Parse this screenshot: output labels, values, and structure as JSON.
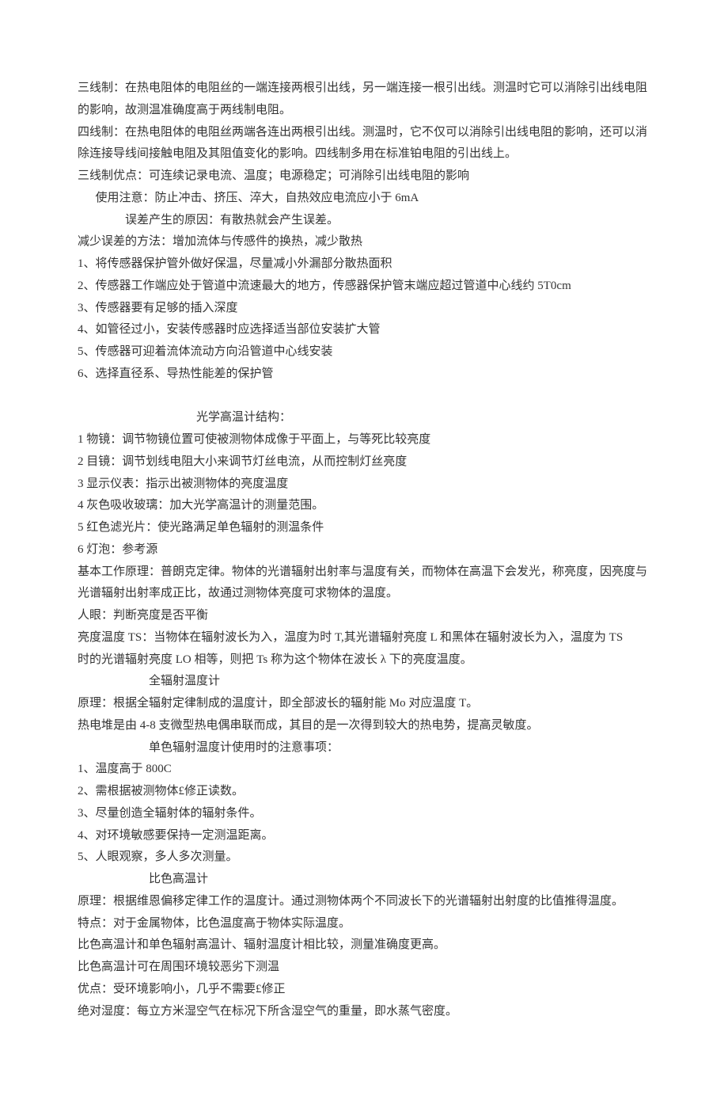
{
  "lines": {
    "l1": "三线制：在热电阻体的电阻丝的一端连接两根引出线，另一端连接一根引出线。测温时它可以消除引出线电阻的影响，故测温准确度高于两线制电阻。",
    "l2": "四线制：在热电阻体的电阻丝两端各连出两根引出线。测温时，它不仅可以消除引出线电阻的影响，还可以消除连接导线间接触电阻及其阻值变化的影响。四线制多用在标准铂电阻的引出线上。",
    "l3": "三线制优点：可连续记录电流、温度；电源稳定；可消除引出线电阻的影响",
    "l4": "使用注意：防止冲击、挤压、淬大，自热效应电流应小于 6mA",
    "l5": "误差产生的原因：有散热就会产生误差。",
    "l6": "减少误差的方法：增加流体与传感件的换热，减少散热",
    "l7": "1、将传感器保护管外做好保温，尽量减小外漏部分散热面积",
    "l8": "2、传感器工作端应处于管道中流速最大的地方，传感器保护管末端应超过管道中心线约 5T0cm",
    "l9": "3、传感器要有足够的插入深度",
    "l10": "4、如管径过小，安装传感器时应选择适当部位安装扩大管",
    "l11": "5、传感器可迎着流体流动方向沿管道中心线安装",
    "l12": "6、选择直径系、导热性能差的保护管",
    "l13": " ",
    "l14": "光学高温计结构：",
    "l15": "1 物镜：调节物镜位置可使被测物体成像于平面上，与等死比较亮度",
    "l16": "2 目镜：调节划线电阻大小来调节灯丝电流，从而控制灯丝亮度",
    "l17": "3 显示仪表：指示出被测物体的亮度温度",
    "l18": "4 灰色吸收玻璃：加大光学高温计的测量范围。",
    "l19": "5 红色滤光片：使光路满足单色辐射的测温条件",
    "l20": "6 灯泡：参考源",
    "l21": "基本工作原理：普朗克定律。物体的光谱辐射出射率与温度有关，而物体在高温下会发光，称亮度，因亮度与光谱辐射出射率成正比，故通过测物体亮度可求物体的温度。",
    "l22": "人眼：判断亮度是否平衡",
    "l23": "亮度温度 TS：当物体在辐射波长为入，温度为时 T,其光谱辐射亮度 L 和黑体在辐射波长为入，温度为 TS",
    "l24": "时的光谱辐射亮度 LO 相等，则把 Ts 称为这个物体在波长 λ 下的亮度温度。",
    "l25": "全辐射温度计",
    "l26": "原理：根据全辐射定律制成的温度计，即全部波长的辐射能 Mo 对应温度 T。",
    "l27": "热电堆是由 4-8 支微型热电偶串联而成，其目的是一次得到较大的热电势，提高灵敏度。",
    "l28": "单色辐射温度计使用时的注意事项：",
    "l29": "1、温度高于 800C",
    "l30": "2、需根据被测物体£修正读数。",
    "l31": "3、尽量创造全辐射体的辐射条件。",
    "l32": "4、对环境敏感要保持一定测温距离。",
    "l33": "5、人眼观察，多人多次测量。",
    "l34": "比色高温计",
    "l35": "原理：根据维恩偏移定律工作的温度计。通过测物体两个不同波长下的光谱辐射出射度的比值推得温度。",
    "l36": "特点：对于金属物体，比色温度高于物体实际温度。",
    "l37": "比色高温计和单色辐射高温计、辐射温度计相比较，测量准确度更高。",
    "l38": "比色高温计可在周围环境较恶劣下测温",
    "l39": "优点：受环境影响小，几乎不需要£修正",
    "l40": "绝对湿度：每立方米湿空气在标况下所含湿空气的重量，即水蒸气密度。"
  }
}
